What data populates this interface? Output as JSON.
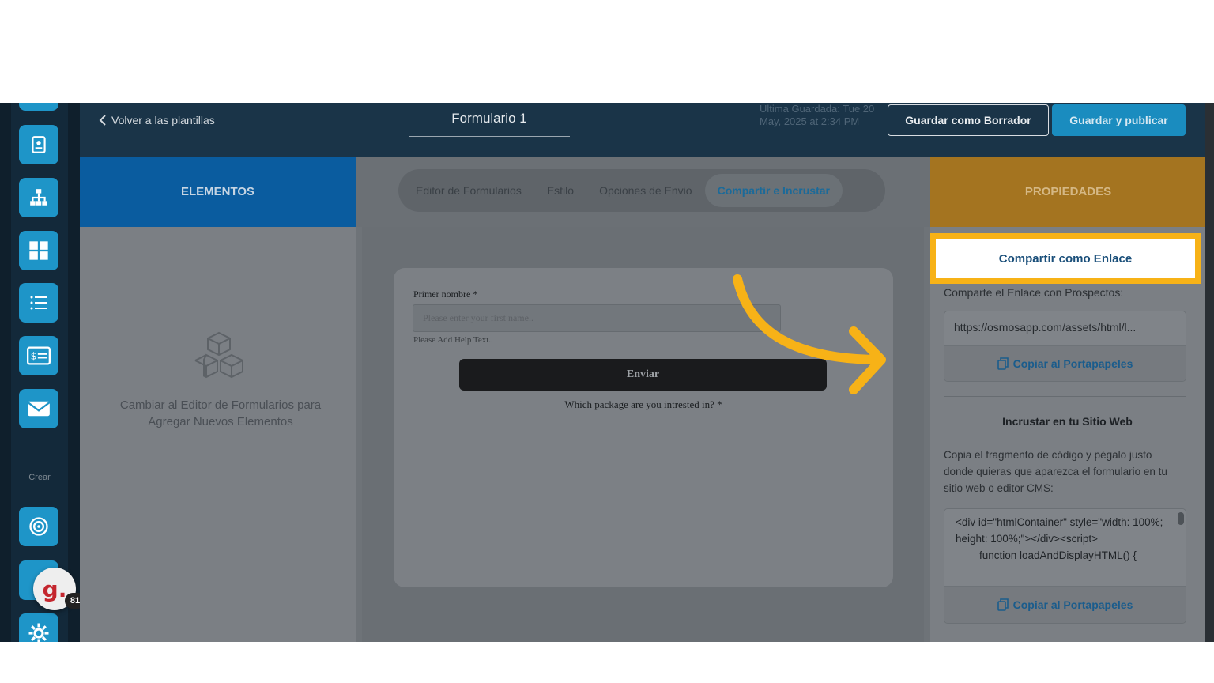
{
  "header": {
    "back_label": "Volver a las plantillas",
    "form_title": "Formulario 1",
    "last_saved": "Ultima Guardada: Tue 20 May, 2025 at 2:34 PM",
    "save_draft_label": "Guardar como Borrador",
    "save_publish_label": "Guardar y publicar"
  },
  "sidebar": {
    "section_label": "Crear",
    "icons": [
      "contact-card-icon",
      "org-chart-icon",
      "grid-icon",
      "list-icon",
      "billing-icon",
      "mail-icon",
      "target-icon",
      "group-icon",
      "settings-icon"
    ]
  },
  "support_widget": {
    "letter": "g.",
    "count": "81"
  },
  "elements_panel": {
    "title": "ELEMENTOS",
    "message": "Cambiar al Editor de Formularios para Agregar Nuevos Elementos"
  },
  "tabs": [
    {
      "label": "Editor de Formularios"
    },
    {
      "label": "Estilo"
    },
    {
      "label": "Opciones de Envio"
    },
    {
      "label": "Compartir e Incrustar"
    }
  ],
  "form": {
    "field_label": "Primer nombre *",
    "field_placeholder": "Please enter your first name..",
    "help_text": "Please Add Help Text..",
    "submit_label": "Enviar",
    "question": "Which package are you intrested in? *"
  },
  "properties": {
    "title": "PROPIEDADES",
    "share_link_label": "Compartir como Enlace",
    "share_sub": "Comparte el Enlace con Prospectos:",
    "url": "https://osmosapp.com/assets/html/l...",
    "copy_label": "Copiar al Portapapeles",
    "embed_title": "Incrustar en tu Sitio Web",
    "embed_desc": "Copia el fragmento de código y pégalo justo donde quieras que aparezca el formulario en tu sitio web o editor CMS:",
    "code_line1": "<div id=\"htmlContainer\" style=\"width: 100%; height: 100%;\"></div><script>",
    "code_line2": "function loadAndDisplayHTML() {",
    "copy_label_2": "Copiar al Portapapeles"
  },
  "colors": {
    "highlight": "#f7b217",
    "elements_header": "#0a5c9f",
    "properties_header": "#a47420",
    "topbar": "#1a3448"
  }
}
